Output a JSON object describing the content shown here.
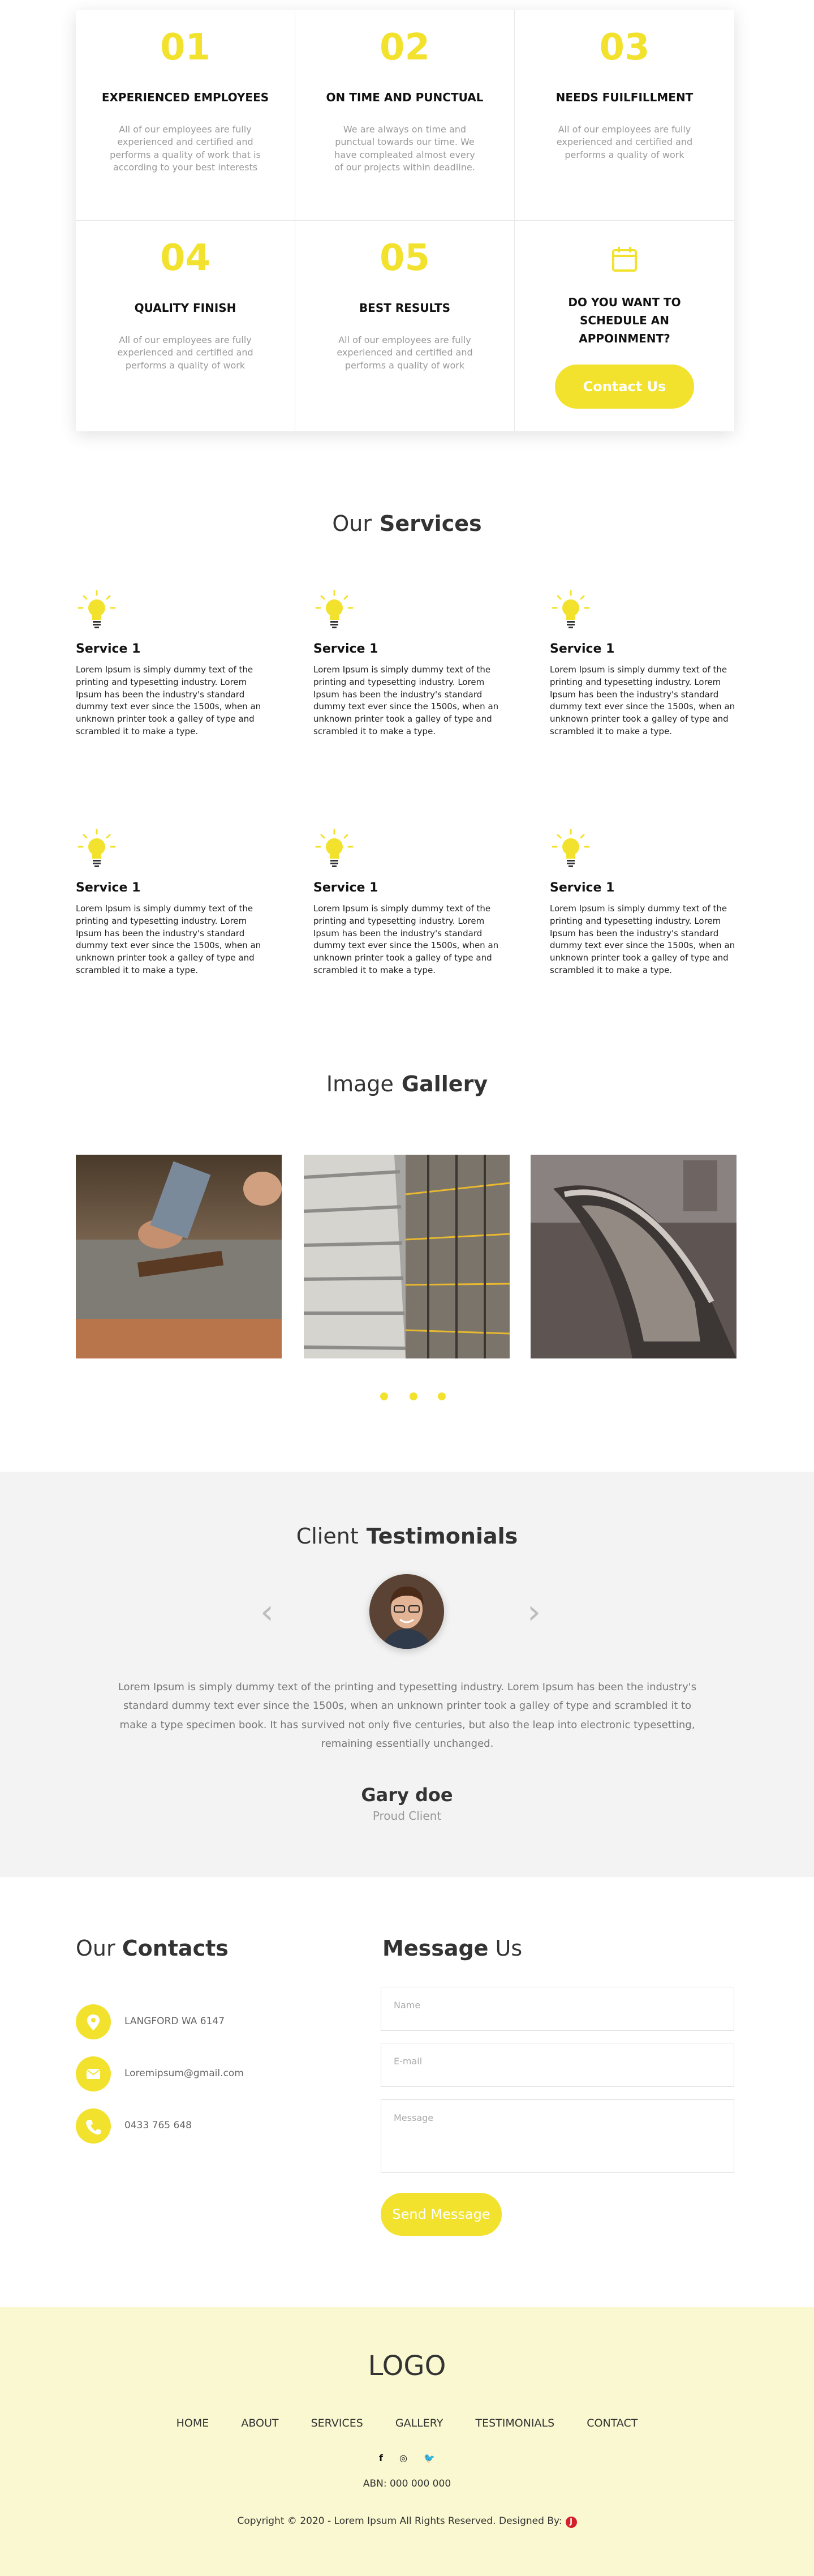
{
  "features": [
    {
      "num": "01",
      "title": "EXPERIENCED EMPLOYEES",
      "desc": "All of our employees are fully experienced and certified and performs a quality of work that is according to your best interests"
    },
    {
      "num": "02",
      "title": "ON TIME AND PUNCTUAL",
      "desc": "We are always on time and punctual towards our time. We have compleated almost every of our projects within deadline."
    },
    {
      "num": "03",
      "title": "NEEDS FUILFILLMENT",
      "desc": "All of our employees are fully experienced and certified and performs a quality of work"
    },
    {
      "num": "04",
      "title": "QUALITY FINISH",
      "desc": "All of our employees are fully experienced and certified and performs a quality of work"
    },
    {
      "num": "05",
      "title": "BEST RESULTS",
      "desc": "All of our employees are fully experienced and certified and performs a quality of work"
    }
  ],
  "schedule": {
    "title": "DO YOU WANT TO SCHEDULE AN APPOINMENT?",
    "button": "Contact Us",
    "icon": "calendar-icon"
  },
  "services_title": {
    "light": "Our",
    "bold": "Services"
  },
  "services": [
    {
      "title": "Service 1",
      "text": "Lorem Ipsum is simply dummy text of the printing and typesetting industry. Lorem Ipsum has been the industry's standard dummy text ever since the 1500s, when an unknown printer took a galley of type and scrambled it to make a type."
    },
    {
      "title": "Service 1",
      "text": "Lorem Ipsum is simply dummy text of the printing and typesetting industry. Lorem Ipsum has been the industry's standard dummy text ever since the 1500s, when an unknown printer took a galley of type and scrambled it to make a type."
    },
    {
      "title": "Service 1",
      "text": "Lorem Ipsum is simply dummy text of the printing and typesetting industry. Lorem Ipsum has been the industry's standard dummy text ever since the 1500s, when an unknown printer took a galley of type and scrambled it to make a type."
    },
    {
      "title": "Service 1",
      "text": "Lorem Ipsum is simply dummy text of the printing and typesetting industry. Lorem Ipsum has been the industry's standard dummy text ever since the 1500s, when an unknown printer took a galley of type and scrambled it to make a type."
    },
    {
      "title": "Service 1",
      "text": "Lorem Ipsum is simply dummy text of the printing and typesetting industry. Lorem Ipsum has been the industry's standard dummy text ever since the 1500s, when an unknown printer took a galley of type and scrambled it to make a type."
    },
    {
      "title": "Service 1",
      "text": "Lorem Ipsum is simply dummy text of the printing and typesetting industry. Lorem Ipsum has been the industry's standard dummy text ever since the 1500s, when an unknown printer took a galley of type and scrambled it to make a type."
    }
  ],
  "gallery_title": {
    "light": "Image",
    "bold": "Gallery"
  },
  "testimonials": {
    "title_light": "Client",
    "title_bold": "Testimonials",
    "quote": "Lorem Ipsum is simply dummy text of the printing and typesetting industry. Lorem Ipsum has been the industry's standard dummy text ever since the 1500s, when an unknown printer took a galley of type and scrambled it to make a type specimen book. It has survived not only five centuries, but also the leap into electronic typesetting, remaining essentially unchanged.",
    "name": "Gary doe",
    "role": "Proud Client",
    "prev": "‹",
    "next": "›"
  },
  "contacts": {
    "title_light": "Our",
    "title_bold": "Contacts",
    "address": "LANGFORD WA 6147",
    "email": "Loremipsum@gmail.com",
    "phone": "0433 765 648"
  },
  "message": {
    "title_bold": "Message",
    "title_light": "Us",
    "name_placeholder": "Name",
    "email_placeholder": "E-mail",
    "message_placeholder": "Message",
    "button": "Send Message"
  },
  "footer": {
    "logo": "LOGO",
    "nav": [
      "HOME",
      "ABOUT",
      "SERVICES",
      "GALLERY",
      "TESTIMONIALS",
      "CONTACT"
    ],
    "social": [
      "f",
      "◎",
      "🐦"
    ],
    "abn": "ABN: 000 000 000",
    "copyright": "Copyright © 2020 - Lorem Ipsum All Rights Reserved. Designed By:",
    "brand_mark": "J"
  },
  "colors": {
    "accent": "#f2e22e",
    "footer_bg": "#f9f8d0",
    "testimonial_bg": "#f3f3f3"
  }
}
